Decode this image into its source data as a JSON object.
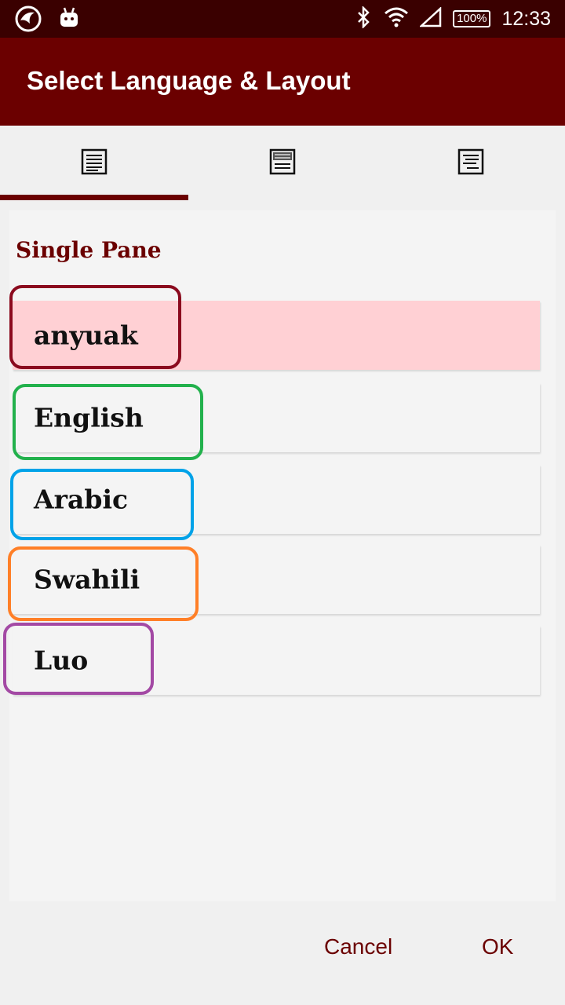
{
  "status_bar": {
    "time": "12:33",
    "battery": "100%",
    "left_icons": [
      "phoenix-app-icon",
      "android-icon"
    ],
    "right_icons": [
      "bluetooth-icon",
      "wifi-icon",
      "cell-signal-icon",
      "battery-icon"
    ]
  },
  "app_bar": {
    "title": "Select Language & Layout"
  },
  "tabs": [
    {
      "icon": "single-pane-icon",
      "selected": true
    },
    {
      "icon": "two-pane-icon",
      "selected": false
    },
    {
      "icon": "interlinear-icon",
      "selected": false
    }
  ],
  "section": {
    "title": "Single Pane"
  },
  "languages": [
    {
      "label": "anyuak",
      "selected": true,
      "outline_color": "#8b0a1e"
    },
    {
      "label": "English",
      "selected": false,
      "outline_color": "#22b14c"
    },
    {
      "label": "Arabic",
      "selected": false,
      "outline_color": "#00a2e8"
    },
    {
      "label": "Swahili",
      "selected": false,
      "outline_color": "#ff7f27"
    },
    {
      "label": "Luo",
      "selected": false,
      "outline_color": "#a349a4"
    }
  ],
  "footer": {
    "cancel_label": "Cancel",
    "ok_label": "OK"
  },
  "colors": {
    "primary": "#6b0000",
    "status_bar": "#3a0000",
    "selected_row": "#ffd0d4"
  }
}
